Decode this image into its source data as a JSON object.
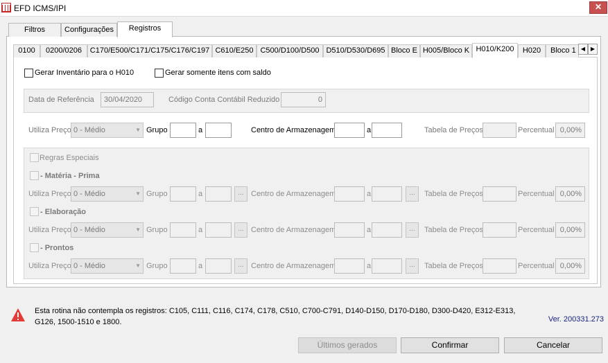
{
  "window": {
    "title": "EFD ICMS/IPI",
    "close_label": "✕"
  },
  "main_tabs": [
    {
      "label": "Filtros"
    },
    {
      "label": "Configurações"
    },
    {
      "label": "Registros"
    }
  ],
  "sub_tabs": [
    {
      "label": "0100"
    },
    {
      "label": "0200/0206"
    },
    {
      "label": "C170/E500/C171/C175/C176/C197"
    },
    {
      "label": "C610/E250"
    },
    {
      "label": "C500/D100/D500"
    },
    {
      "label": "D510/D530/D695"
    },
    {
      "label": "Bloco E"
    },
    {
      "label": "H005/Bloco K"
    },
    {
      "label": "H010/K200"
    },
    {
      "label": "H020"
    },
    {
      "label": "Bloco 1"
    }
  ],
  "options": {
    "gerar_inventario": "Gerar Inventário para o H010",
    "gerar_somente_saldo": "Gerar somente itens com saldo"
  },
  "reference": {
    "data_label": "Data de Referência",
    "data_value": "30/04/2020",
    "conta_label": "Código Conta Contábil Reduzido",
    "conta_value": "0"
  },
  "general_row": {
    "utiliza_preco_label": "Utiliza Preço",
    "utiliza_preco_value": "0 - Médio",
    "grupo_label": "Grupo",
    "a_label": "a",
    "centro_label": "Centro de Armazenagem",
    "tabela_label": "Tabela de Preços",
    "percentual_label": "Percentual",
    "percentual_value": "0,00%"
  },
  "special": {
    "regras_label": "Regras Especiais",
    "sections": [
      {
        "title": "- Matéria - Prima"
      },
      {
        "title": "- Elaboração"
      },
      {
        "title": "- Prontos"
      }
    ],
    "row": {
      "utiliza_preco_label": "Utiliza Preço",
      "utiliza_preco_value": "0 - Médio",
      "grupo_label": "Grupo",
      "a_label": "a",
      "dots_label": "...",
      "centro_label": "Centro de Armazenagem",
      "tabela_label": "Tabela de Preços",
      "percentual_label": "Percentual",
      "percentual_value": "0,00%"
    }
  },
  "footer": {
    "message_line1": "Esta rotina não contempla os registros: C105, C111, C116, C174, C178, C510, C700-C791, D140-D150, D170-D180, D300-D420, E312-E313,",
    "message_line2": "G126, 1500-1510 e 1800.",
    "version": "Ver. 200331.273",
    "btn_ultimos": "Últimos gerados",
    "btn_confirmar": "Confirmar",
    "btn_cancelar": "Cancelar"
  }
}
